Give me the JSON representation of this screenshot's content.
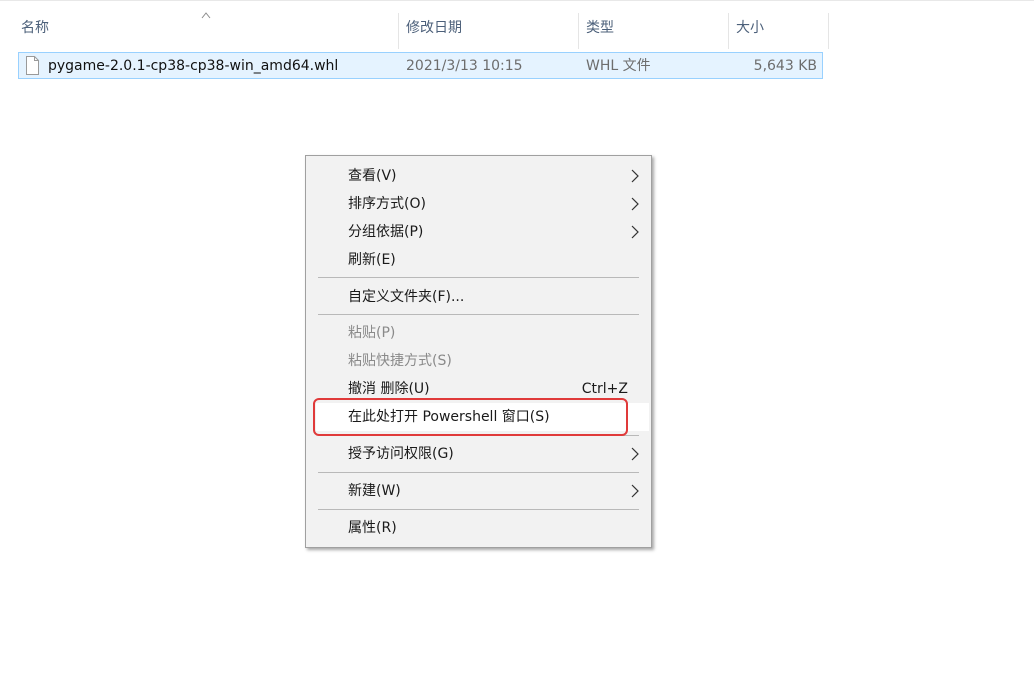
{
  "columns": {
    "name": "名称",
    "date": "修改日期",
    "type": "类型",
    "size": "大小"
  },
  "file": {
    "name": "pygame-2.0.1-cp38-cp38-win_amd64.whl",
    "date": "2021/3/13 10:15",
    "type": "WHL 文件",
    "size": "5,643 KB"
  },
  "menu": {
    "view": "查看(V)",
    "sort": "排序方式(O)",
    "group": "分组依据(P)",
    "refresh": "刷新(E)",
    "customize": "自定义文件夹(F)...",
    "paste": "粘贴(P)",
    "paste_shortcut": "粘贴快捷方式(S)",
    "undo": "撤消 删除(U)",
    "undo_shortcut": "Ctrl+Z",
    "powershell": "在此处打开 Powershell 窗口(S)",
    "access": "授予访问权限(G)",
    "new": "新建(W)",
    "properties": "属性(R)"
  },
  "colors": {
    "highlight_border": "#e03a3a",
    "selection_bg": "#e5f3ff",
    "selection_border": "#99d1ff"
  }
}
